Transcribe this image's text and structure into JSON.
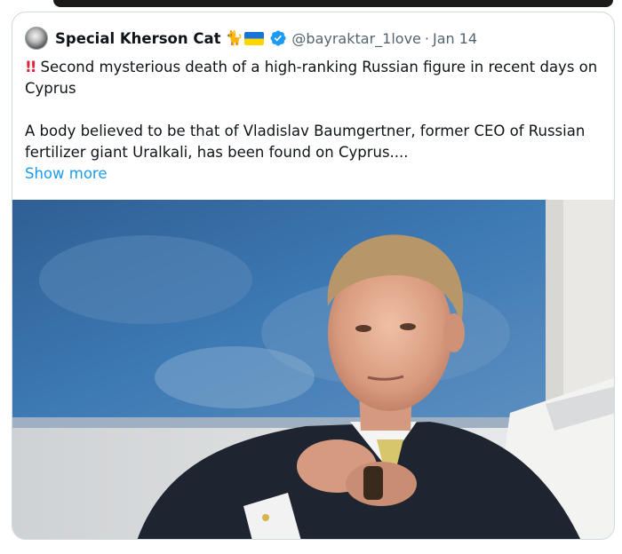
{
  "tweet": {
    "author": {
      "display_name": "Special Kherson Cat",
      "emoji": [
        "cat-icon",
        "ukraine-flag-icon"
      ],
      "verified": true,
      "handle": "@bayraktar_1love",
      "separator": "·",
      "date": "Jan 14"
    },
    "text": {
      "line1_prefix_icon": "double-exclamation-icon",
      "paragraph1": "Second mysterious death of a high-ranking Russian figure in recent days on Cyprus",
      "paragraph2": "A body believed to be that of Vladislav Baumgertner, former CEO of Russian fertilizer giant Uralkali, has been found on Cyprus....",
      "show_more": "Show more"
    },
    "media": {
      "type": "photo",
      "subject": "man-in-suit-portrait"
    },
    "colors": {
      "link": "#1d9bf0",
      "secondary_text": "#536471",
      "verified_badge": "#1d9bf0",
      "alert": "#e0243c",
      "border": "#cfd9de"
    }
  }
}
